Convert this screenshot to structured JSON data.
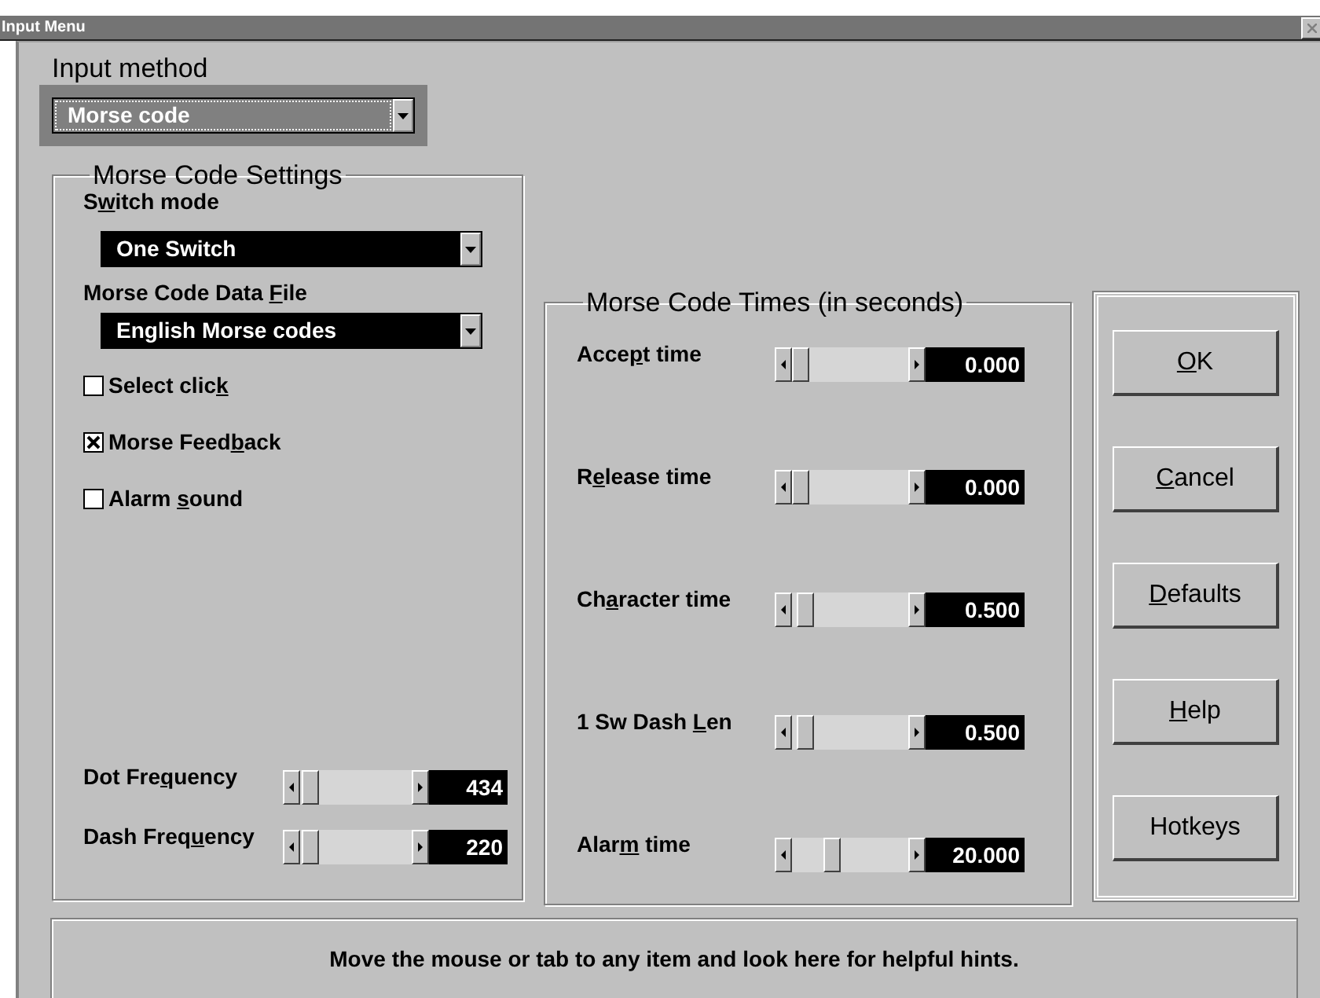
{
  "window": {
    "title": "Input Menu"
  },
  "input_method": {
    "label": "Input method",
    "value": "Morse code",
    "focused": true
  },
  "settings": {
    "title": "Morse Code Settings",
    "switch_mode": {
      "label": [
        "S",
        {
          "hotkey": "w"
        },
        "itch mode"
      ],
      "value": "One Switch",
      "focused": false
    },
    "data_file": {
      "label": [
        "Morse Code Data ",
        {
          "hotkey": "F"
        },
        "ile"
      ],
      "value": "English Morse codes",
      "focused": false
    },
    "checkboxes": [
      {
        "label": [
          "Select clic",
          {
            "hotkey": "k"
          }
        ],
        "checked": false
      },
      {
        "label": [
          "Morse Feed",
          {
            "hotkey": "b"
          },
          "ack"
        ],
        "checked": true
      },
      {
        "label": [
          "Alarm ",
          {
            "hotkey": "s"
          },
          "ound"
        ],
        "checked": false
      }
    ],
    "frequencies": [
      {
        "label": [
          "Dot Fre",
          {
            "hotkey": "q"
          },
          "uency"
        ],
        "level": 0.02,
        "reading": "434"
      },
      {
        "label": [
          "Dash Freq",
          {
            "hotkey": "u"
          },
          "ency"
        ],
        "level": 0.01,
        "reading": "220"
      }
    ]
  },
  "times": {
    "title": "Morse Code Times (in seconds)",
    "rows": [
      {
        "label": [
          "Acce",
          {
            "hotkey": "p"
          },
          "t time"
        ],
        "level": 0.0,
        "reading": "0.000"
      },
      {
        "label": [
          "R",
          {
            "hotkey": "e"
          },
          "lease time"
        ],
        "level": 0.0,
        "reading": "0.000"
      },
      {
        "label": [
          "Ch",
          {
            "hotkey": "a"
          },
          "racter time"
        ],
        "level": 0.04,
        "reading": "0.500"
      },
      {
        "label": [
          "1 Sw Dash ",
          {
            "hotkey": "L"
          },
          "en"
        ],
        "level": 0.04,
        "reading": "0.500"
      },
      {
        "label": [
          "Alar",
          {
            "hotkey": "m"
          },
          " time"
        ],
        "level": 0.32,
        "reading": "20.000"
      }
    ]
  },
  "buttons": [
    {
      "label": [
        {
          "hotkey": "O"
        },
        "K"
      ]
    },
    {
      "label": [
        {
          "hotkey": "C"
        },
        "ancel"
      ]
    },
    {
      "label": [
        {
          "hotkey": "D"
        },
        "efaults"
      ]
    },
    {
      "label": [
        {
          "hotkey": "H"
        },
        "elp"
      ]
    },
    {
      "label": [
        "Hotkeys"
      ]
    }
  ],
  "hint": "Move the mouse or tab to any item and look here for helpful hints."
}
